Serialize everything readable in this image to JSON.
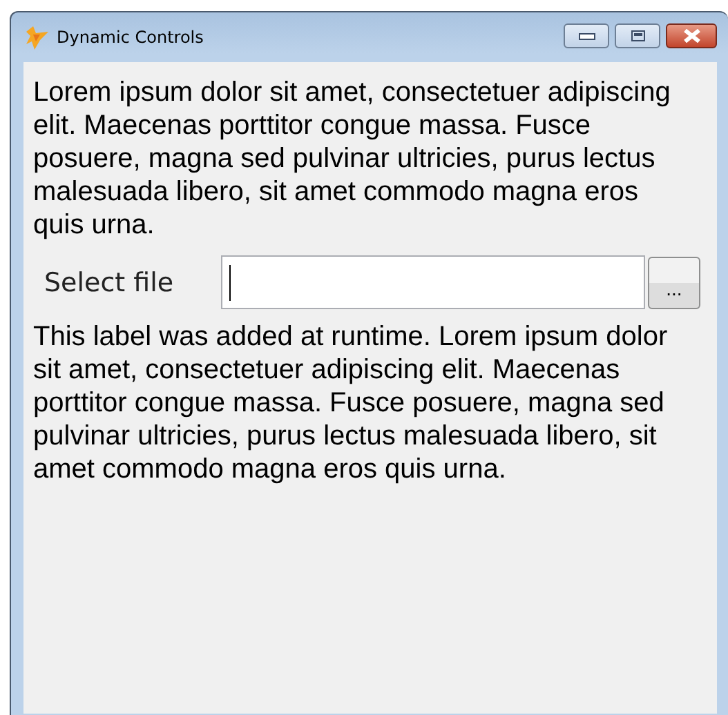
{
  "window": {
    "title": "Dynamic Controls"
  },
  "intro_text": "Lorem ipsum dolor sit amet, consectetuer adipiscing elit. Maecenas porttitor congue massa. Fusce posuere, magna sed pulvinar ultricies, purus lectus malesuada libero, sit amet commodo magna eros quis urna.",
  "file_picker": {
    "label": "Select file",
    "browse_button": "..."
  },
  "runtime_text": "This label was added at runtime. Lorem ipsum dolor sit amet, consectetuer adipiscing elit. Maecenas porttitor congue massa. Fusce posuere, magna sed pulvinar ultricies, purus lectus malesuada libero, sit amet commodo magna eros quis urna."
}
